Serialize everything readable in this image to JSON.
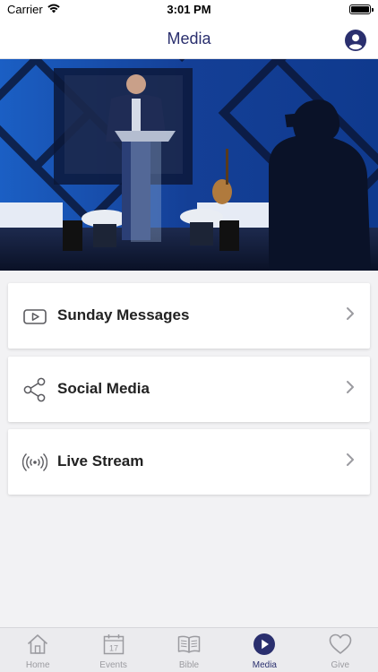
{
  "status_bar": {
    "carrier": "Carrier",
    "time": "3:01 PM",
    "icons": [
      "wifi-icon",
      "battery-icon"
    ]
  },
  "nav": {
    "title": "Media",
    "profile_icon": "user-profile-icon"
  },
  "colors": {
    "accent": "#2a2f6e",
    "inactive": "#9b9ba0",
    "icon_gray": "#5a5a5f",
    "card_bg": "#ffffff",
    "page_bg": "#f2f2f4"
  },
  "hero": {
    "description_icon": "sermon-photo"
  },
  "menu": [
    {
      "label": "Sunday Messages",
      "icon": "play-video-icon"
    },
    {
      "label": "Social Media",
      "icon": "share-icon"
    },
    {
      "label": "Live Stream",
      "icon": "broadcast-icon"
    }
  ],
  "tabs": [
    {
      "label": "Home",
      "icon": "home-icon",
      "active": false
    },
    {
      "label": "Events",
      "icon": "calendar-icon",
      "date_number": "17",
      "active": false
    },
    {
      "label": "Bible",
      "icon": "book-icon",
      "active": false
    },
    {
      "label": "Media",
      "icon": "play-circle-icon",
      "active": true
    },
    {
      "label": "Give",
      "icon": "heart-icon",
      "active": false
    }
  ]
}
